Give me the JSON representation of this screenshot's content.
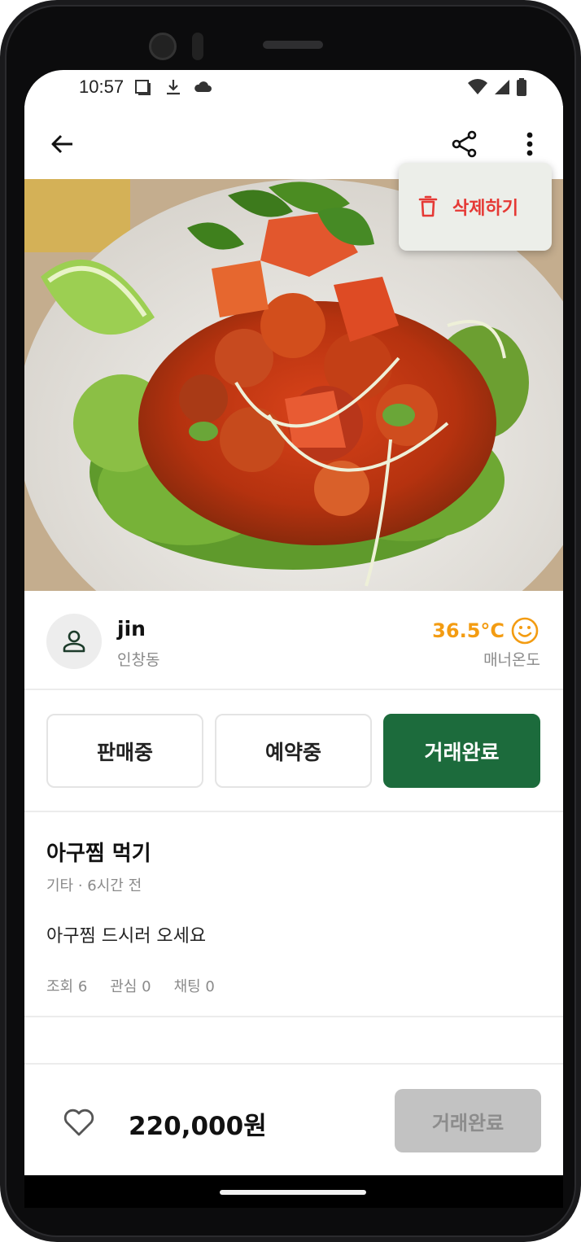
{
  "status_bar": {
    "time": "10:57",
    "left_icons": [
      "screenshot-icon",
      "download-icon",
      "cloud-icon"
    ],
    "right_icons": [
      "wifi-icon",
      "signal-icon",
      "battery-icon"
    ]
  },
  "app_bar": {
    "back_icon": "arrow-left-icon",
    "share_icon": "share-icon",
    "more_icon": "more-vertical-icon"
  },
  "menu": {
    "delete_label": "삭제하기",
    "delete_color": "#e53935"
  },
  "seller": {
    "name": "jin",
    "location": "인창동",
    "temperature": "36.5°C",
    "temperature_label": "매너온도",
    "temperature_color": "#f39c12"
  },
  "status_tabs": [
    {
      "label": "판매중",
      "active": false
    },
    {
      "label": "예약중",
      "active": false
    },
    {
      "label": "거래완료",
      "active": true
    }
  ],
  "post": {
    "title": "아구찜 먹기",
    "meta": "기타 · 6시간 전",
    "description": "아구찜 드시러 오세요",
    "stats": {
      "views": "조회 6",
      "likes": "관심 0",
      "chats": "채팅 0"
    }
  },
  "bottom": {
    "price": "220,000원",
    "action_label": "거래완료",
    "accent_color": "#1c6b3c"
  }
}
